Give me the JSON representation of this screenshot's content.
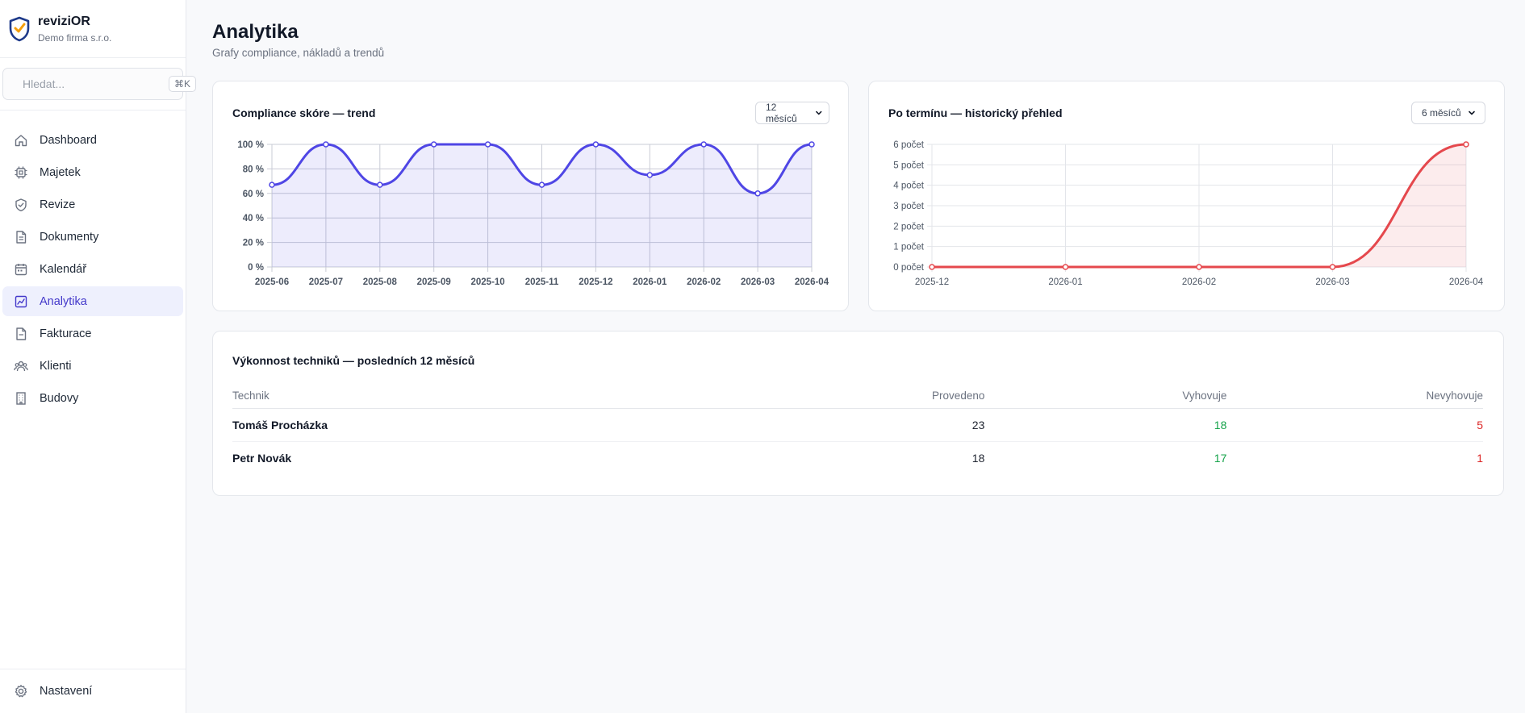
{
  "brand": {
    "name": "reviziOR",
    "company": "Demo firma s.r.o."
  },
  "search": {
    "placeholder": "Hledat...",
    "shortcut": "⌘K"
  },
  "nav": [
    {
      "label": "Dashboard",
      "icon": "home-icon"
    },
    {
      "label": "Majetek",
      "icon": "chip-icon"
    },
    {
      "label": "Revize",
      "icon": "shield-check-icon"
    },
    {
      "label": "Dokumenty",
      "icon": "document-icon"
    },
    {
      "label": "Kalendář",
      "icon": "calendar-icon"
    },
    {
      "label": "Analytika",
      "icon": "chart-icon",
      "active": true
    },
    {
      "label": "Fakturace",
      "icon": "invoice-icon"
    },
    {
      "label": "Klienti",
      "icon": "users-icon"
    },
    {
      "label": "Budovy",
      "icon": "building-icon"
    }
  ],
  "settings": {
    "label": "Nastavení",
    "icon": "gear-icon"
  },
  "page": {
    "title": "Analytika",
    "subtitle": "Grafy compliance, nákladů a trendů"
  },
  "colors": {
    "accent": "#4f46e5",
    "danger": "#e5484d",
    "good": "#16a34a",
    "bad": "#dc2626"
  },
  "compliance_card": {
    "title": "Compliance skóre — trend",
    "range": "12 měsíců"
  },
  "overdue_card": {
    "title": "Po termínu — historický přehled",
    "range": "6 měsíců"
  },
  "techs_card": {
    "title": "Výkonnost techniků — posledních 12 měsíců",
    "columns": [
      "Technik",
      "Provedeno",
      "Vyhovuje",
      "Nevyhovuje"
    ],
    "rows": [
      {
        "name": "Tomáš Procházka",
        "done": "23",
        "pass": "18",
        "fail": "5"
      },
      {
        "name": "Petr Novák",
        "done": "18",
        "pass": "17",
        "fail": "1"
      }
    ]
  },
  "chart_data": [
    {
      "type": "area",
      "x": [
        "2025-06",
        "2025-07",
        "2025-08",
        "2025-09",
        "2025-10",
        "2025-11",
        "2025-12",
        "2026-01",
        "2026-02",
        "2026-03",
        "2026-04"
      ],
      "values": [
        67,
        100,
        67,
        100,
        100,
        67,
        100,
        75,
        100,
        60,
        100
      ],
      "ylim": [
        0,
        100
      ],
      "yticks": [
        "0 %",
        "20 %",
        "40 %",
        "60 %",
        "80 %",
        "100 %"
      ],
      "grid": true,
      "color": "#4f46e5"
    },
    {
      "type": "area",
      "x": [
        "2025-12",
        "2026-01",
        "2026-02",
        "2026-03",
        "2026-04"
      ],
      "values": [
        0,
        0,
        0,
        0,
        6
      ],
      "ylim": [
        0,
        6
      ],
      "yticks": [
        "0 počet",
        "1 počet",
        "2 počet",
        "3 počet",
        "4 počet",
        "5 počet",
        "6 počet"
      ],
      "grid": true,
      "color": "#e5484d"
    }
  ]
}
